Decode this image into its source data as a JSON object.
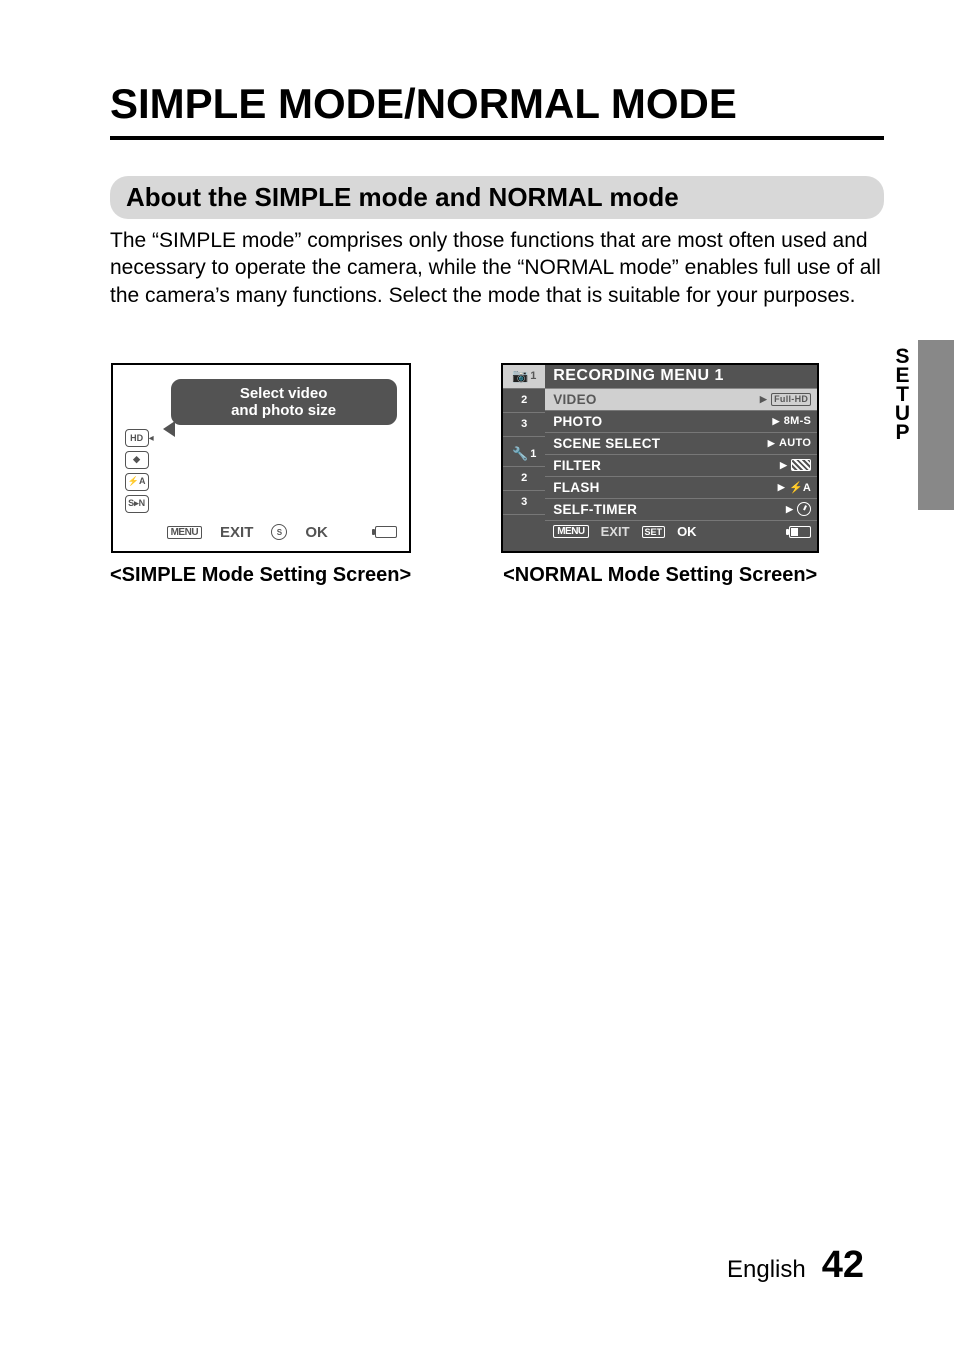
{
  "title": "SIMPLE MODE/NORMAL MODE",
  "subtitle": "About the SIMPLE mode and NORMAL mode",
  "body": "The “SIMPLE mode” comprises only those functions that are most often used and necessary to operate the camera, while the “NORMAL mode” enables full use of all the camera’s many functions. Select the mode that is suitable for your purposes.",
  "simple_screen": {
    "bubble_line1": "Select video",
    "bubble_line2": "and photo size",
    "icons": [
      "HD",
      "◆",
      "⚡A",
      "S▸N"
    ],
    "footer_menu_label": "MENU",
    "footer_exit": "EXIT",
    "footer_set_label": "SET",
    "footer_ok": "OK",
    "caption": "<SIMPLE Mode Setting Screen>"
  },
  "normal_screen": {
    "left_tabs_group1": [
      "1",
      "2",
      "3"
    ],
    "left_tabs_group2": [
      "1",
      "2",
      "3"
    ],
    "header": "RECORDING MENU 1",
    "rows": [
      {
        "label": "VIDEO",
        "value": "Full-HD",
        "selected": true
      },
      {
        "label": "PHOTO",
        "value": "8M-S",
        "selected": false
      },
      {
        "label": "SCENE SELECT",
        "value": "AUTO",
        "selected": false
      },
      {
        "label": "FILTER",
        "value": "pattern",
        "selected": false
      },
      {
        "label": "FLASH",
        "value": "⚡A",
        "selected": false
      },
      {
        "label": "SELF-TIMER",
        "value": "timer",
        "selected": false
      }
    ],
    "footer_menu_label": "MENU",
    "footer_exit": "EXIT",
    "footer_set_label": "SET",
    "footer_ok": "OK",
    "caption": "<NORMAL Mode Setting Screen>"
  },
  "side_tab": "SETUP",
  "footer_lang": "English",
  "footer_page": "42"
}
